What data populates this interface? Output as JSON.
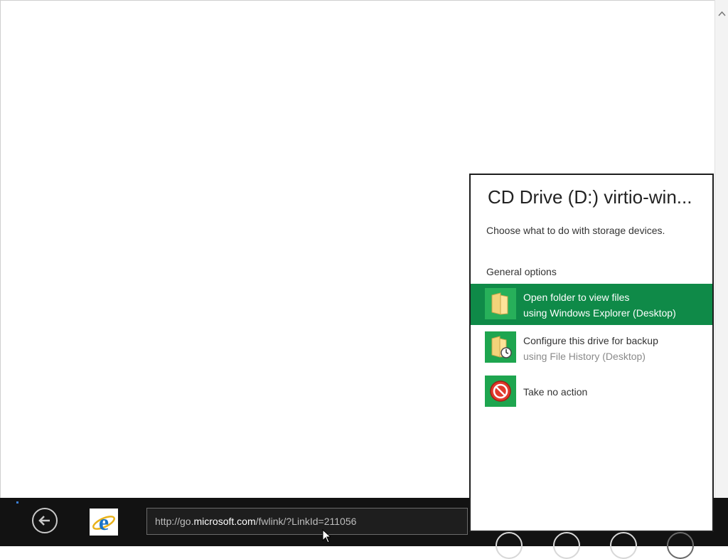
{
  "browser": {
    "address": {
      "prefix": "http://go.",
      "domain": "microsoft.com",
      "path": "/fwlink/?LinkId=211056"
    },
    "icons": {
      "back": "back-arrow-icon",
      "tab": "internet-explorer-icon",
      "scroll_up": "chevron-up-icon"
    }
  },
  "autoplay": {
    "title": "CD Drive (D:) virtio-win...",
    "subtitle": "Choose what to do with storage devices.",
    "section": "General options",
    "options": [
      {
        "line1": "Open folder to view files",
        "line2": "using Windows Explorer (Desktop)",
        "icon": "folder-icon",
        "selected": true
      },
      {
        "line1": "Configure this drive for backup",
        "line2": "using File History (Desktop)",
        "icon": "file-history-icon",
        "selected": false
      },
      {
        "line1": "Take no action",
        "line2": "",
        "icon": "no-action-icon",
        "selected": false
      }
    ]
  },
  "colors": {
    "accent_green": "#0f8a48",
    "tile_green": "#1ea54f",
    "appbar": "#121212"
  }
}
